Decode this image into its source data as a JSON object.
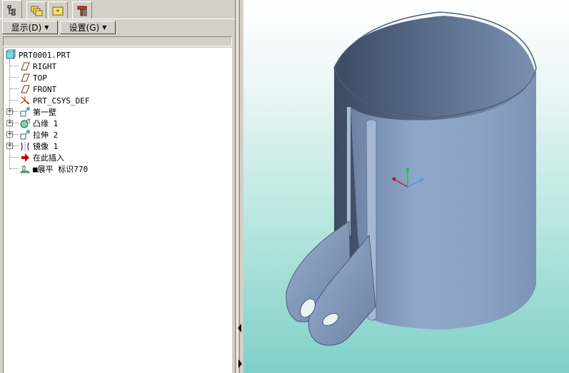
{
  "tabs": [
    {
      "name": "model-tree-tab-icon",
      "active": true
    },
    {
      "name": "layers-tab-icon",
      "active": false
    },
    {
      "name": "favorites-tab-icon",
      "active": false
    },
    {
      "name": "tools-tab-icon",
      "active": false
    }
  ],
  "menu": {
    "show_label": "显示(D)",
    "settings_label": "设置(G)"
  },
  "tree": {
    "root": "PRT0001.PRT",
    "items": [
      {
        "label": "RIGHT",
        "icon": "datum-plane-icon",
        "expandable": false
      },
      {
        "label": "TOP",
        "icon": "datum-plane-icon",
        "expandable": false
      },
      {
        "label": "FRONT",
        "icon": "datum-plane-icon",
        "expandable": false
      },
      {
        "label": "PRT_CSYS_DEF",
        "icon": "coordinate-system-icon",
        "expandable": false
      },
      {
        "label": "第一壁",
        "icon": "first-wall-icon",
        "expandable": true
      },
      {
        "label": "凸缘 1",
        "icon": "flange-icon",
        "expandable": true
      },
      {
        "label": "拉伸 2",
        "icon": "extrude-icon",
        "expandable": true
      },
      {
        "label": "镜像 1",
        "icon": "mirror-icon",
        "expandable": true
      },
      {
        "label": "在此插入",
        "icon": "insert-here-arrow-icon",
        "expandable": false
      },
      {
        "label": "■展平 标识770",
        "icon": "flatten-icon",
        "expandable": false
      }
    ]
  },
  "colors": {
    "model_body": "#8ea7c8",
    "model_dark": "#5a6e8c",
    "viewport_top": "#ffffff",
    "viewport_bottom": "#7fd0c8",
    "insert_arrow": "#cc0000"
  }
}
